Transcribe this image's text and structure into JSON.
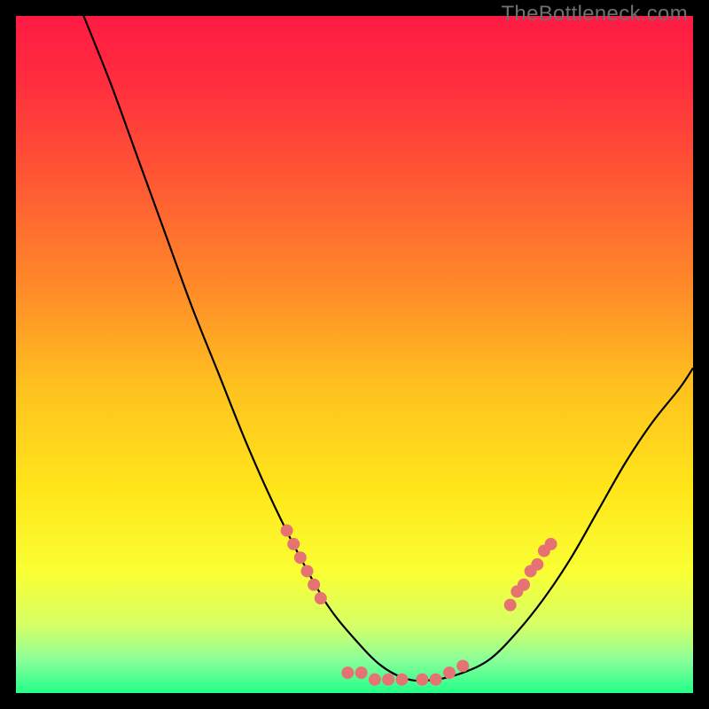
{
  "watermark": "TheBottleneck.com",
  "chart_data": {
    "type": "line",
    "title": "",
    "xlabel": "",
    "ylabel": "",
    "xlim": [
      0,
      100
    ],
    "ylim": [
      0,
      100
    ],
    "background_gradient": {
      "stops": [
        {
          "offset": 0.0,
          "color": "#ff1a44"
        },
        {
          "offset": 0.1,
          "color": "#ff2e3e"
        },
        {
          "offset": 0.25,
          "color": "#ff5a33"
        },
        {
          "offset": 0.4,
          "color": "#ff8a29"
        },
        {
          "offset": 0.55,
          "color": "#ffc21f"
        },
        {
          "offset": 0.7,
          "color": "#ffe61a"
        },
        {
          "offset": 0.82,
          "color": "#faff33"
        },
        {
          "offset": 0.9,
          "color": "#d6ff66"
        },
        {
          "offset": 0.95,
          "color": "#8cff99"
        },
        {
          "offset": 1.0,
          "color": "#22ff88"
        }
      ]
    },
    "series": [
      {
        "name": "bottleneck-curve",
        "color": "#000000",
        "x": [
          10,
          14,
          18,
          22,
          26,
          30,
          34,
          38,
          42,
          46,
          50,
          54,
          58,
          62,
          66,
          70,
          74,
          78,
          82,
          86,
          90,
          94,
          98,
          100
        ],
        "y": [
          100,
          90,
          79,
          68,
          57,
          47,
          37,
          28,
          20,
          13,
          8,
          4,
          2,
          2,
          3,
          5,
          9,
          14,
          20,
          27,
          34,
          40,
          45,
          48
        ]
      }
    ],
    "markers": {
      "name": "highlight-dots",
      "color": "#e57373",
      "radius": 7,
      "points": [
        {
          "x": 40,
          "y": 24
        },
        {
          "x": 41,
          "y": 22
        },
        {
          "x": 42,
          "y": 20
        },
        {
          "x": 43,
          "y": 18
        },
        {
          "x": 44,
          "y": 16
        },
        {
          "x": 45,
          "y": 14
        },
        {
          "x": 49,
          "y": 3
        },
        {
          "x": 51,
          "y": 3
        },
        {
          "x": 53,
          "y": 2
        },
        {
          "x": 55,
          "y": 2
        },
        {
          "x": 57,
          "y": 2
        },
        {
          "x": 60,
          "y": 2
        },
        {
          "x": 62,
          "y": 2
        },
        {
          "x": 64,
          "y": 3
        },
        {
          "x": 66,
          "y": 4
        },
        {
          "x": 73,
          "y": 13
        },
        {
          "x": 74,
          "y": 15
        },
        {
          "x": 75,
          "y": 16
        },
        {
          "x": 76,
          "y": 18
        },
        {
          "x": 77,
          "y": 19
        },
        {
          "x": 78,
          "y": 21
        },
        {
          "x": 79,
          "y": 22
        }
      ]
    }
  }
}
